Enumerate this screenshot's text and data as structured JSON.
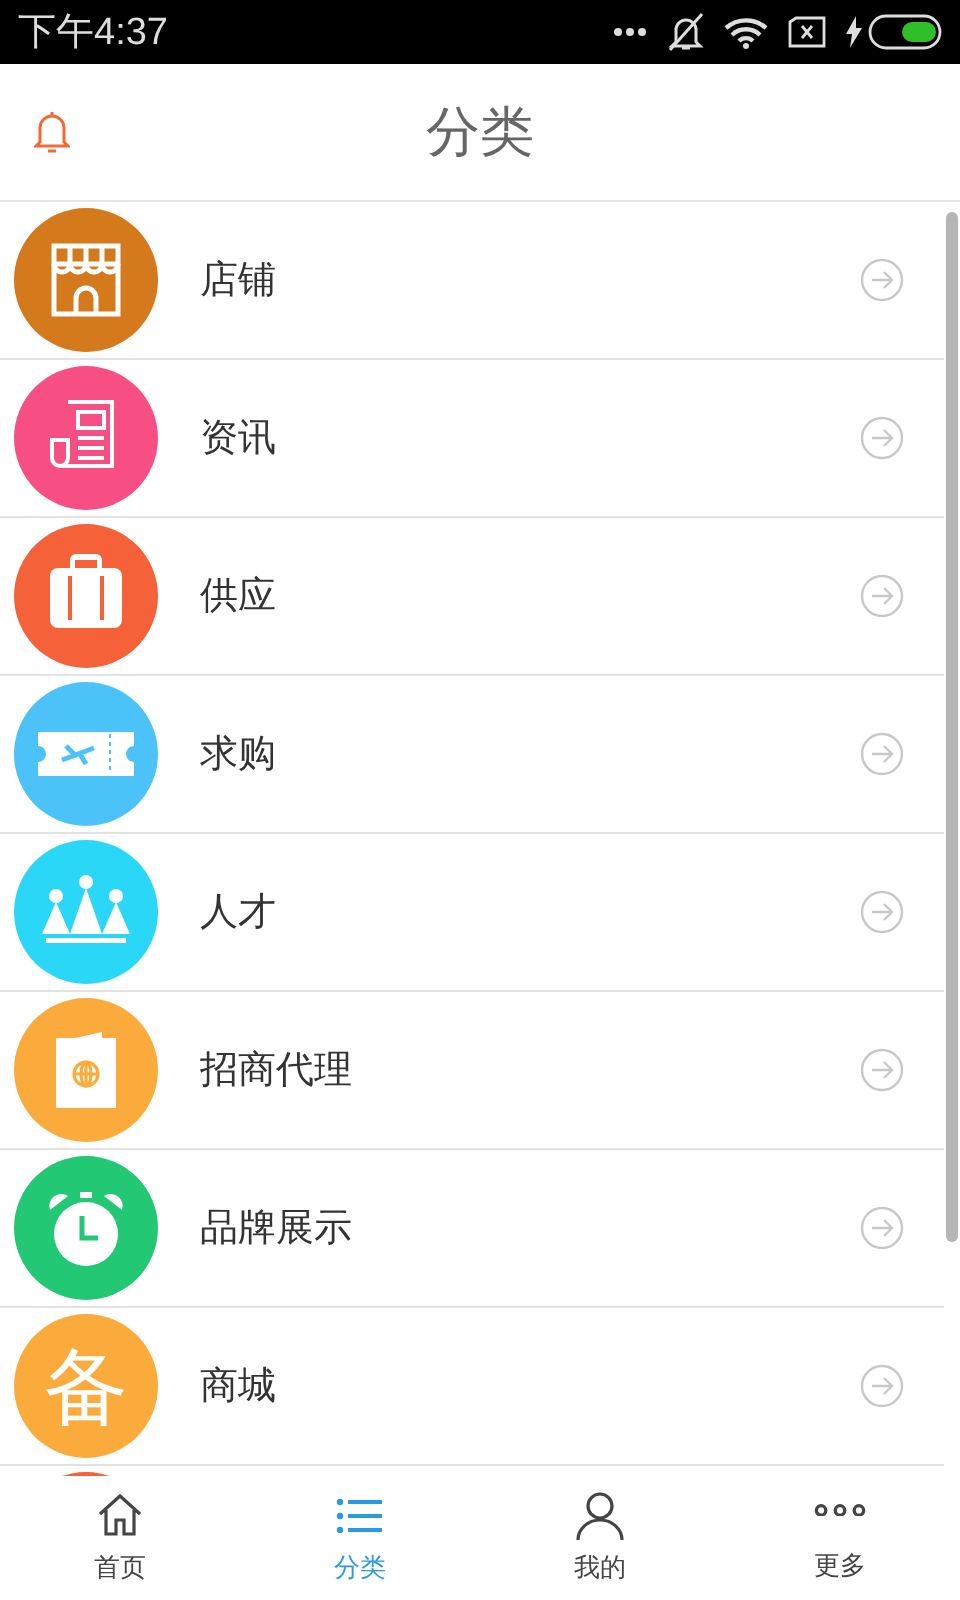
{
  "status_bar": {
    "time": "下午4:37"
  },
  "header": {
    "title": "分类"
  },
  "categories": [
    {
      "kind": "shop",
      "label": "店铺",
      "color": "#d5791d"
    },
    {
      "kind": "news",
      "label": "资讯",
      "color": "#f74f84"
    },
    {
      "kind": "luggage",
      "label": "供应",
      "color": "#f5623a"
    },
    {
      "kind": "ticket",
      "label": "求购",
      "color": "#4cc3f8"
    },
    {
      "kind": "crown",
      "label": "人才",
      "color": "#2bd7f6"
    },
    {
      "kind": "passport",
      "label": "招商代理",
      "color": "#fbab3c"
    },
    {
      "kind": "clock",
      "label": "品牌展示",
      "color": "#23c874"
    },
    {
      "kind": "glyph",
      "glyph": "备",
      "label": "商城",
      "color": "#fbab3c"
    },
    {
      "kind": "partial",
      "color": "#f5623a"
    }
  ],
  "tabs": [
    {
      "kind": "home",
      "label": "首页",
      "selected": false
    },
    {
      "kind": "list",
      "label": "分类",
      "selected": true
    },
    {
      "kind": "user",
      "label": "我的",
      "selected": false
    },
    {
      "kind": "more",
      "label": "更多",
      "selected": false
    }
  ]
}
